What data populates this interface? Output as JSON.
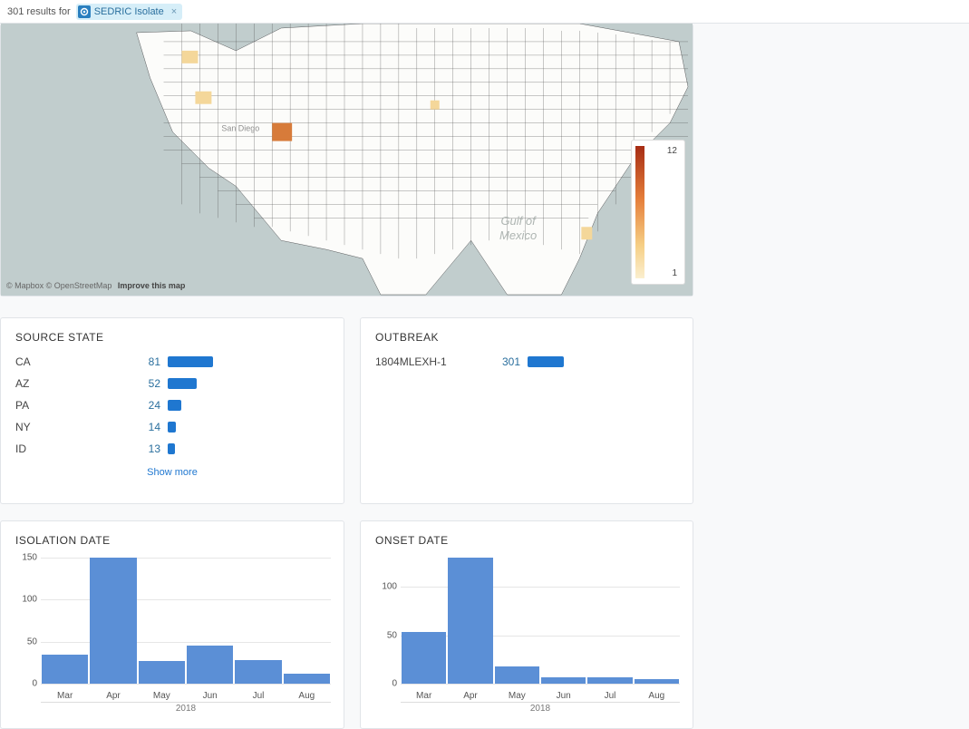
{
  "header": {
    "results_text": "301 results for",
    "chip_label": "SEDRIC Isolate",
    "chip_close": "×"
  },
  "map": {
    "attrib_mapbox": "© Mapbox",
    "attrib_osm": "© OpenStreetMap",
    "attrib_improve": "Improve this map",
    "legend_max": "12",
    "legend_min": "1",
    "gulf_label_1": "Gulf of",
    "gulf_label_2": "Mexico"
  },
  "source_state": {
    "title": "SOURCE STATE",
    "max_bar": 81,
    "items": [
      {
        "label": "CA",
        "value": 81
      },
      {
        "label": "AZ",
        "value": 52
      },
      {
        "label": "PA",
        "value": 24
      },
      {
        "label": "NY",
        "value": 14
      },
      {
        "label": "ID",
        "value": 13
      }
    ],
    "show_more": "Show more"
  },
  "outbreak": {
    "title": "OUTBREAK",
    "max_bar": 301,
    "items": [
      {
        "label": "1804MLEXH-1",
        "value": 301
      }
    ]
  },
  "chart_data": [
    {
      "type": "bar",
      "title": "ISOLATION DATE",
      "categories": [
        "Mar",
        "Apr",
        "May",
        "Jun",
        "Jul",
        "Aug"
      ],
      "values": [
        35,
        152,
        27,
        45,
        28,
        12
      ],
      "xlabel": "2018",
      "ylabel": "",
      "ylim": [
        0,
        150
      ],
      "yticks": [
        0,
        50,
        100,
        150
      ]
    },
    {
      "type": "bar",
      "title": "ONSET DATE",
      "categories": [
        "Mar",
        "Apr",
        "May",
        "Jun",
        "Jul",
        "Aug"
      ],
      "values": [
        53,
        130,
        18,
        7,
        7,
        5
      ],
      "xlabel": "2018",
      "ylabel": "",
      "ylim": [
        0,
        130
      ],
      "yticks": [
        0,
        50,
        100
      ]
    }
  ]
}
